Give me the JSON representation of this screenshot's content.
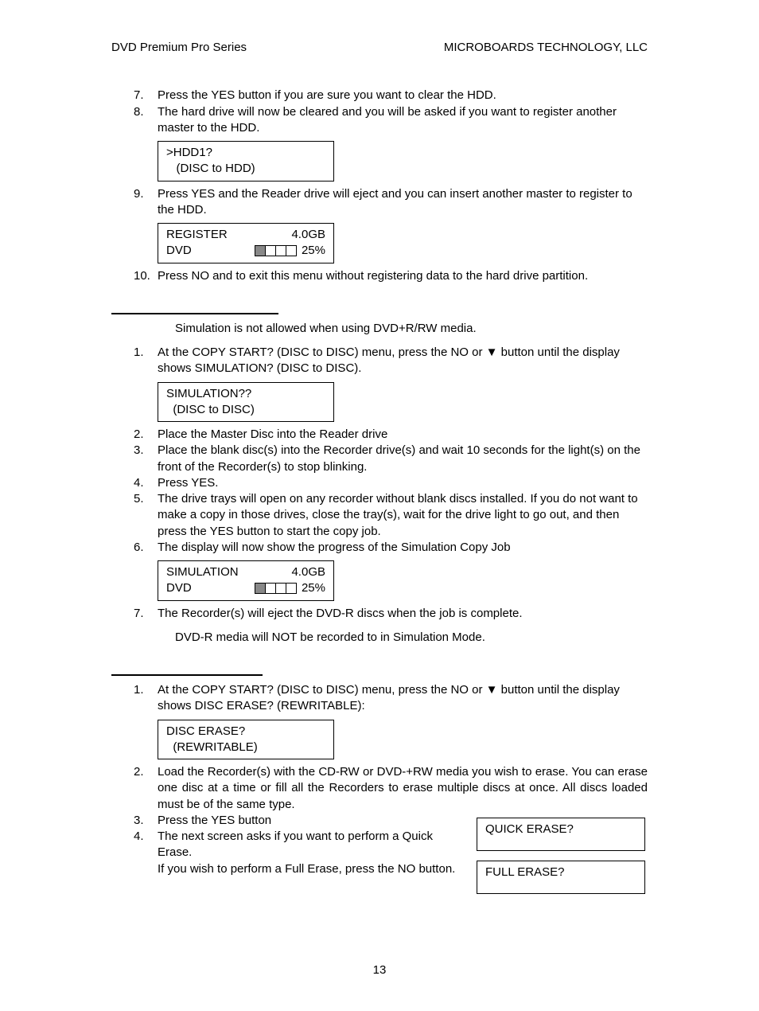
{
  "header": {
    "left": "DVD Premium Pro Series",
    "right": "MICROBOARDS TECHNOLOGY, LLC"
  },
  "block1": {
    "item7_num": "7.",
    "item7": "Press the YES button if you are sure you want to clear the HDD.",
    "item8_num": "8.",
    "item8": "The hard drive will now be cleared and you will be asked if you want to register another master to the HDD.",
    "lcd1_line1": ">HDD1?",
    "lcd1_line2": "   (DISC to HDD)",
    "item9_num": "9.",
    "item9": "Press YES and the Reader drive will eject and you can insert another master to register to the HDD.",
    "lcd2_r1_left": "REGISTER",
    "lcd2_r1_right": "4.0GB",
    "lcd2_r2_left": "DVD",
    "lcd2_pct": "25%",
    "item10_num": "10.",
    "item10": "Press NO and to exit this menu without registering data to the hard drive partition."
  },
  "block2": {
    "note": "Simulation is not allowed when using DVD+R/RW media.",
    "item1_num": "1.",
    "item1": "At the COPY START? (DISC to DISC) menu, press the NO or ▼ button until the display shows SIMULATION? (DISC to DISC).",
    "lcd1_line1": "SIMULATION??",
    "lcd1_line2": "  (DISC to DISC)",
    "item2_num": "2.",
    "item2": "Place the Master Disc into the Reader drive",
    "item3_num": "3.",
    "item3": "Place the blank disc(s) into the Recorder drive(s) and wait 10 seconds for the light(s) on the front of the Recorder(s) to stop blinking.",
    "item4_num": "4.",
    "item4": "Press YES.",
    "item5_num": "5.",
    "item5": "The drive trays will open on any recorder without blank discs installed.  If you do not want to make a copy in those drives, close the tray(s), wait for the drive light to go out, and then press the YES button to start the copy job.",
    "item6_num": "6.",
    "item6": "The display will now show the progress of the Simulation Copy Job",
    "lcd2_r1_left": "SIMULATION",
    "lcd2_r1_right": "4.0GB",
    "lcd2_r2_left": "DVD",
    "lcd2_pct": "25%",
    "item7_num": "7.",
    "item7": "The Recorder(s) will eject the DVD-R discs when the job is complete.",
    "note2": "DVD-R media will NOT be recorded to in Simulation Mode."
  },
  "block3": {
    "item1_num": "1.",
    "item1": "At the COPY START? (DISC to DISC) menu, press the NO or ▼ button until the display shows DISC ERASE? (REWRITABLE):",
    "lcd1_line1": "DISC ERASE?",
    "lcd1_line2": "  (REWRITABLE)",
    "item2_num": "2.",
    "item2": "Load the Recorder(s) with the CD-RW or DVD-+RW media you wish to erase.  You can erase one disc at a time or fill all the Recorders to erase multiple discs at once.  All discs loaded must be of the same type.",
    "item3_num": "3.",
    "item3": "Press the YES button",
    "item4_num": "4.",
    "item4": "The next screen asks if you want to perform a Quick Erase.",
    "item4b": "If you wish to perform a Full Erase, press the NO button.",
    "side1": "QUICK ERASE?",
    "side2": "FULL ERASE?"
  },
  "pagenum": "13"
}
